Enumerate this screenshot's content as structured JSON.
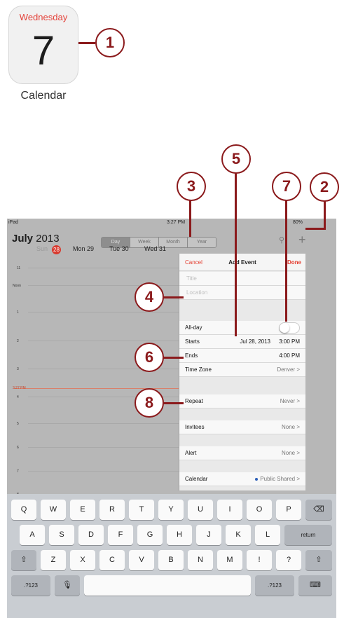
{
  "app_icon": {
    "day": "Wednesday",
    "date": "7",
    "name": "Calendar"
  },
  "callouts": [
    "1",
    "2",
    "3",
    "4",
    "5",
    "6",
    "7",
    "8"
  ],
  "status_bar": {
    "device": "iPad",
    "time": "3:27 PM",
    "battery": "80%"
  },
  "header": {
    "month": "July",
    "year": "2013",
    "view_tabs": [
      "Day",
      "Week",
      "Month",
      "Year"
    ],
    "selected_tab": "Day"
  },
  "days": {
    "sun": "Sun",
    "today_num": "28",
    "mon": "Mon 29",
    "tue": "Tue 30",
    "wed": "Wed 31"
  },
  "hours": [
    "11",
    "Noon",
    "1",
    "2",
    "3",
    "4",
    "5",
    "6",
    "7",
    "8"
  ],
  "now_label": "3:27 PM",
  "add_event": {
    "cancel": "Cancel",
    "title": "Add Event",
    "done": "Done",
    "title_placeholder": "Title",
    "location_placeholder": "Location",
    "all_day": "All-day",
    "starts_label": "Starts",
    "starts_date": "Jul 28, 2013",
    "starts_time": "3:00 PM",
    "ends_label": "Ends",
    "ends_time": "4:00 PM",
    "timezone_label": "Time Zone",
    "timezone_value": "Denver >",
    "repeat_label": "Repeat",
    "repeat_value": "Never >",
    "invitees_label": "Invitees",
    "invitees_value": "None >",
    "alert_label": "Alert",
    "alert_value": "None >",
    "calendar_label": "Calendar",
    "calendar_value": "Public Shared >"
  },
  "keyboard": {
    "row1": [
      "Q",
      "W",
      "E",
      "R",
      "T",
      "Y",
      "U",
      "I",
      "O",
      "P"
    ],
    "row2": [
      "A",
      "S",
      "D",
      "F",
      "G",
      "H",
      "J",
      "K",
      "L"
    ],
    "row3": [
      "Z",
      "X",
      "C",
      "V",
      "B",
      "N",
      "M",
      "!",
      "?"
    ],
    "return": "return",
    "numbers": ".?123",
    "backspace": "⌫",
    "shift": "⇧",
    "mic": "🎙",
    "hide": "⌨"
  },
  "colors": {
    "accent_red": "#e43c2e",
    "callout": "#8b1a1c",
    "today": "#d83a2f"
  }
}
